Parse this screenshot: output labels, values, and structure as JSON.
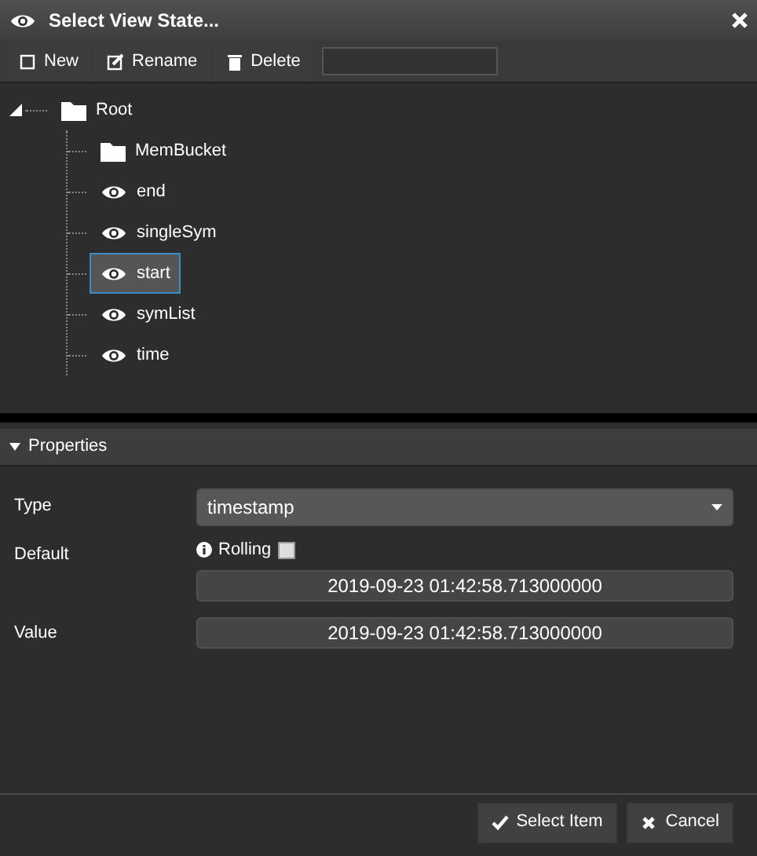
{
  "window": {
    "title": "Select View State..."
  },
  "toolbar": {
    "buttons": [
      {
        "kind": "new",
        "label": "New"
      },
      {
        "kind": "rename",
        "label": "Rename"
      },
      {
        "kind": "delete",
        "label": "Delete"
      }
    ]
  },
  "tree": {
    "label": "Root",
    "kind": "folder",
    "expanded": true,
    "selected": false,
    "children": [
      {
        "label": "MemBucket",
        "kind": "folder",
        "selected": false
      },
      {
        "label": "end",
        "kind": "view",
        "selected": false
      },
      {
        "label": "singleSym",
        "kind": "view",
        "selected": false
      },
      {
        "label": "start",
        "kind": "view",
        "selected": true
      },
      {
        "label": "symList",
        "kind": "view",
        "selected": false
      },
      {
        "label": "time",
        "kind": "view",
        "selected": false
      }
    ]
  },
  "properties": {
    "title": "Properties",
    "expanded": true,
    "type": {
      "label": "Type",
      "value": "timestamp"
    },
    "default": {
      "label": "Default",
      "rolling_label": "Rolling",
      "rolling": false,
      "value": "2019-09-23 01:42:58.713000000"
    },
    "value": {
      "label": "Value",
      "value": "2019-09-23 01:42:58.713000000"
    }
  },
  "buttons": [
    {
      "kind": "ok",
      "label": "Select Item"
    },
    {
      "kind": "cancel",
      "label": "Cancel"
    }
  ]
}
